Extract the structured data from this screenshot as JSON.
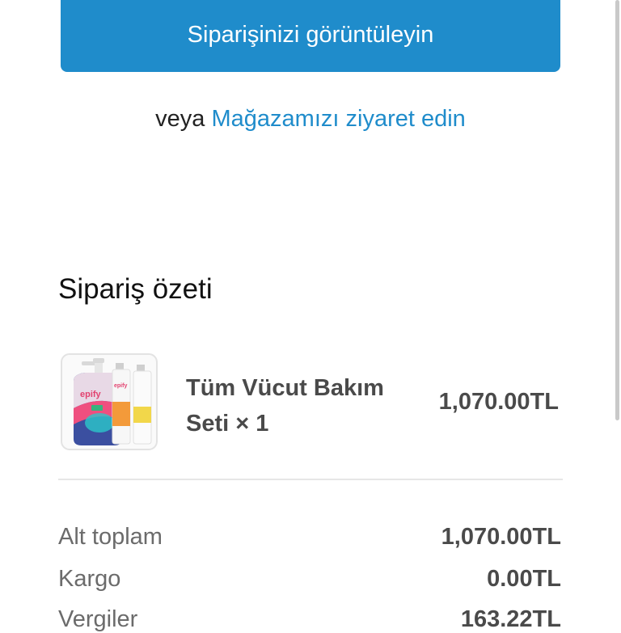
{
  "order_button": {
    "label": "Siparişinizi görüntüleyin"
  },
  "store_link": {
    "prefix": "veya",
    "label": "Mağazamızı ziyaret edin"
  },
  "summary": {
    "title": "Sipariş özeti",
    "item": {
      "name": "Tüm Vücut Bakım Seti",
      "qty_text": "× 1",
      "price": "1,070.00TL",
      "brand": "epify"
    },
    "rows": [
      {
        "label": "Alt toplam",
        "value": "1,070.00TL"
      },
      {
        "label": "Kargo",
        "value": "0.00TL"
      },
      {
        "label": "Vergiler",
        "value": "163.22TL"
      }
    ]
  },
  "colors": {
    "accent": "#1f8ccb",
    "text": "#222222",
    "muted": "#6b6b6b"
  }
}
